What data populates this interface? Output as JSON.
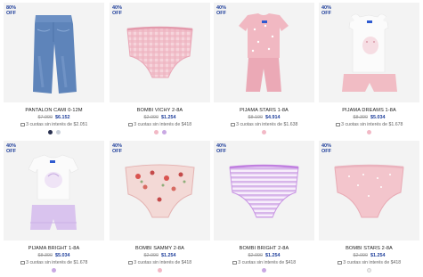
{
  "products": [
    {
      "badge": "80%\nOFF",
      "badge_l1": "80%",
      "badge_l2": "OFF",
      "name": "PANTALON CAMI 0-12M",
      "old_price": "$7.990",
      "price": "$6.152",
      "installments": "3 cuotas sin interés de $2.051",
      "colors": [
        "#2a3150",
        "#c9d0da"
      ]
    },
    {
      "badge_l1": "40%",
      "badge_l2": "OFF",
      "name": "BOMBI VICHY 2-8A",
      "old_price": "$2.090",
      "price": "$1.254",
      "installments": "3 cuotas sin interés de $418",
      "colors": [
        "#f2b9c6",
        "#c9a9e3"
      ]
    },
    {
      "badge_l1": "40%",
      "badge_l2": "OFF",
      "name": "PIJAMA STARS 1-8A",
      "old_price": "$8.190",
      "price": "$4.914",
      "installments": "3 cuotas sin interés de $1.638",
      "colors": [
        "#f2b9c6"
      ]
    },
    {
      "badge_l1": "40%",
      "badge_l2": "OFF",
      "name": "PIJAMA DREAMS 1-8A",
      "old_price": "$8.390",
      "price": "$5.034",
      "installments": "3 cuotas sin interés de $1.678",
      "colors": [
        "#f2b9c6"
      ]
    },
    {
      "badge_l1": "40%",
      "badge_l2": "OFF",
      "name": "PIJAMA BRIGHT 1-8A",
      "old_price": "$8.390",
      "price": "$5.034",
      "installments": "3 cuotas sin interés de $1.678",
      "colors": [
        "#c9a9e3"
      ]
    },
    {
      "badge_l1": "40%",
      "badge_l2": "OFF",
      "name": "BOMBI SAMMY 2-8A",
      "old_price": "$2.090",
      "price": "$1.254",
      "installments": "3 cuotas sin interés de $418",
      "colors": [
        "#f2b9c6"
      ]
    },
    {
      "badge_l1": "40%",
      "badge_l2": "OFF",
      "name": "BOMBI BRIGHT 2-8A",
      "old_price": "$2.090",
      "price": "$1.254",
      "installments": "3 cuotas sin interés de $418",
      "colors": [
        "#c9a9e3"
      ]
    },
    {
      "badge_l1": "40%",
      "badge_l2": "OFF",
      "name": "BOMBI STARS 2-8A",
      "old_price": "$2.090",
      "price": "$1.254",
      "installments": "3 cuotas sin interés de $418",
      "colors": [
        "#eeeeee"
      ]
    }
  ],
  "accent_color": "#1f3f9b"
}
